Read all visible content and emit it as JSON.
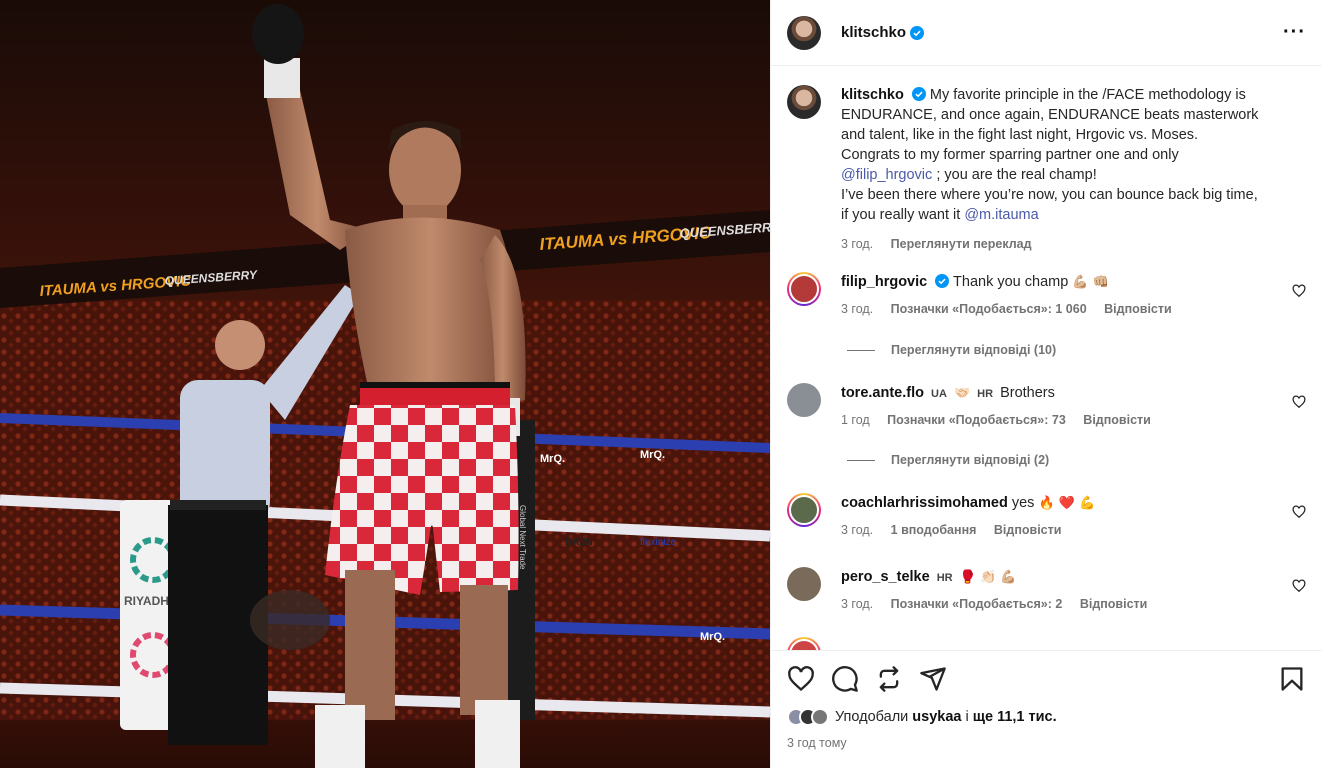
{
  "post": {
    "username": "klitschko",
    "more_icon": "more-icon",
    "caption_lines": [
      "My favorite principle in the /FACE methodology is",
      "ENDURANCE, and once again, ENDURANCE beats masterwork",
      "and talent, like in the fight last night, Hrgovic vs. Moses.",
      "Congrats to my former sparring partner one and only"
    ],
    "caption_mention1": "@filip_hrgovic",
    "caption_after_mention1": " ; you are the real champ!",
    "caption_line6": "I’ve been there where you’re now, you can bounce back big time,",
    "caption_line7_prefix": "if you really want it ",
    "caption_mention2": "@m.itauma",
    "caption_time": "3 год.",
    "see_translation": "Переглянути переклад"
  },
  "photo": {
    "banner_texts": [
      "ITAUMA vs HRGOVIC",
      "QUEENSBERRY",
      "ITAUMA vs HRGOVIC",
      "QUEENSBERRY"
    ],
    "ring_texts": [
      "MrQ.",
      "MrQ.",
      "MrQ.",
      "DAZN",
      "flexinize",
      "Global Next Trade",
      "RIYADH SEASON"
    ]
  },
  "comments": [
    {
      "username": "filip_hrgovic",
      "verified": true,
      "text": "Thank you champ",
      "emojis": "💪🏼 👊🏼",
      "time": "3 год.",
      "likes": "Позначки «Подобається»: 1 060",
      "reply": "Відповісти",
      "view_replies": "Переглянути відповіді (10)",
      "avatar_color": "#b43a3a"
    },
    {
      "username": "tore.ante.flo",
      "cc1": "UA",
      "emoji_mid": "🤝🏻",
      "cc2": "HR",
      "text": "Brothers",
      "time": "1 год",
      "likes": "Позначки «Подобається»: 73",
      "reply": "Відповісти",
      "view_replies": "Переглянути відповіді (2)",
      "avatar_color": "#8a8f96"
    },
    {
      "username": "coachlarhrissimohamed",
      "text": "yes",
      "emojis": "🔥 ❤️ 💪",
      "time": "3 год.",
      "likes": "1 вподобання",
      "reply": "Відповісти",
      "avatar_color": "#5a6a4a"
    },
    {
      "username": "pero_s_telke",
      "cc1": "HR",
      "emojis": "🥊 👏🏻 💪🏼",
      "time": "3 год.",
      "likes": "Позначки «Подобається»: 2",
      "reply": "Відповісти",
      "avatar_color": "#7a6a5a"
    }
  ],
  "actions": {
    "like_icon": "heart-icon",
    "comment_icon": "comment-icon",
    "repost_icon": "repost-icon",
    "share_icon": "share-icon",
    "save_icon": "bookmark-icon"
  },
  "likes": {
    "prefix": "Уподобали ",
    "user": "usykaa",
    "middle": " і ",
    "others": "ще 11,1 тис."
  },
  "post_time": "3 год тому",
  "colors": {
    "mention": "#4a5aa8",
    "secondary_text": "#737373",
    "verified": "#0095f6"
  }
}
